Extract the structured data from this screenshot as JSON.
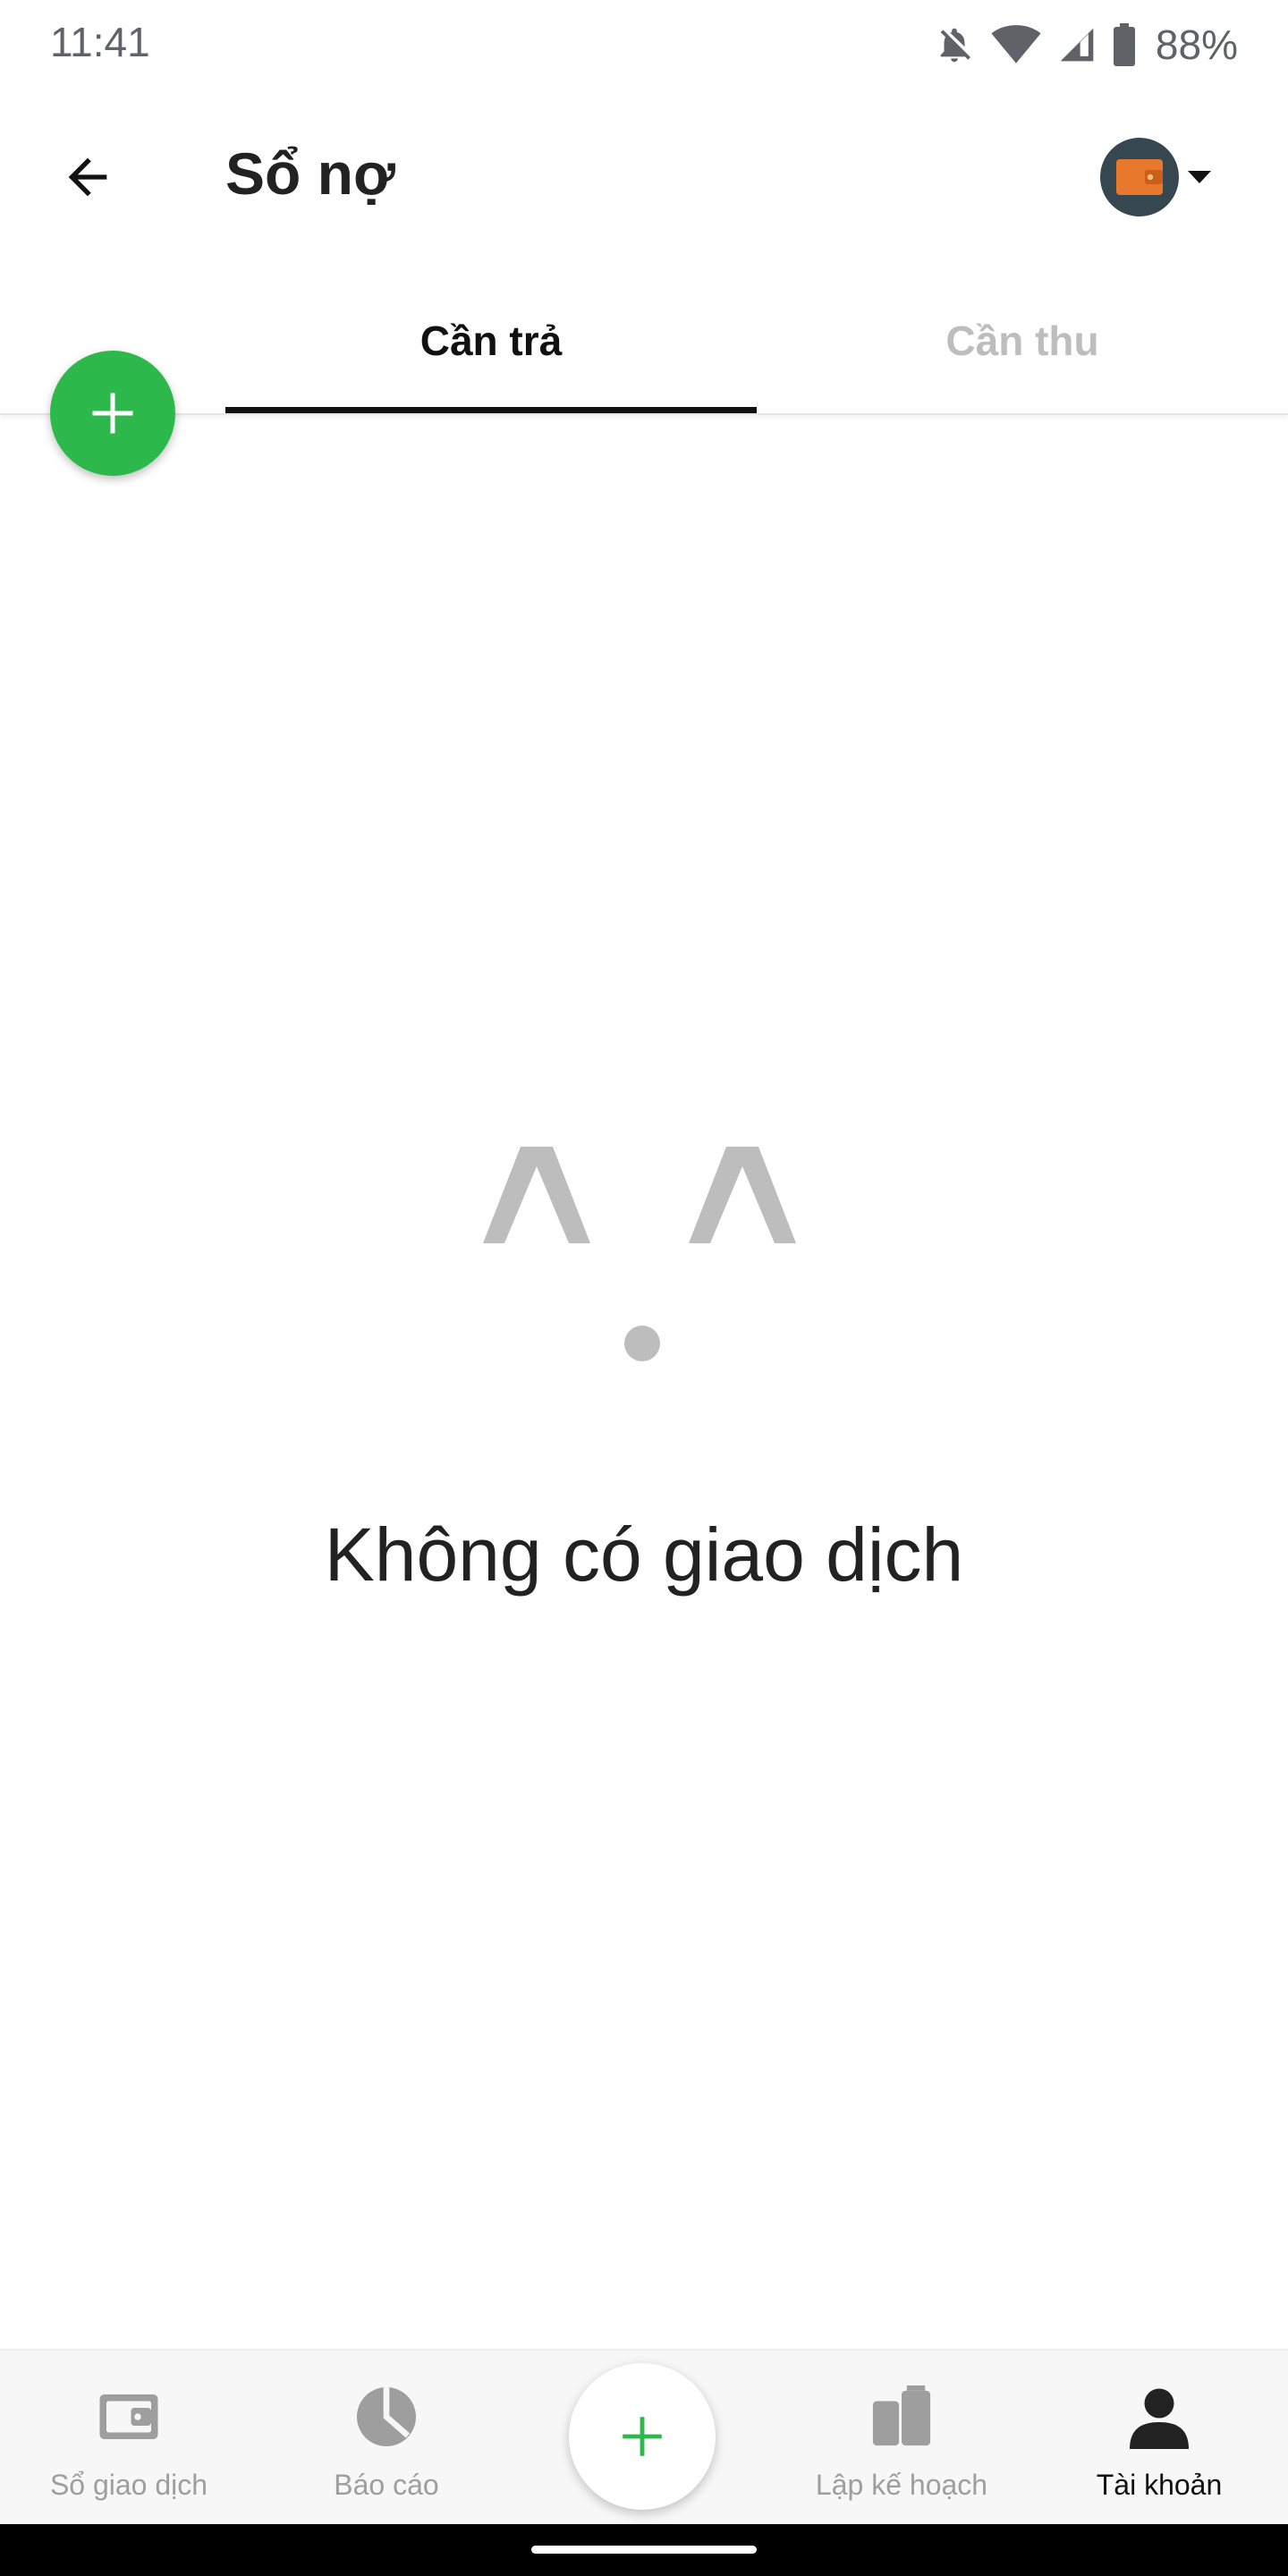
{
  "status_bar": {
    "time": "11:41",
    "battery": "88%",
    "icons": [
      "notifications-off-icon",
      "wifi-icon",
      "cellular-signal-icon",
      "battery-icon"
    ]
  },
  "app_bar": {
    "title": "Sổ nợ",
    "back_icon": "arrow-back-icon",
    "wallet_icon": "wallet-icon",
    "wallet_color": "#e8792c"
  },
  "tabs": [
    {
      "label": "Cần trả",
      "active": true
    },
    {
      "label": "Cần thu",
      "active": false
    }
  ],
  "fab": {
    "icon": "plus-icon",
    "color": "#2db84c"
  },
  "empty_state": {
    "message": "Không có giao dịch",
    "illustration": "sad-face-icon"
  },
  "bottom_nav": {
    "items": [
      {
        "label": "Sổ giao dịch",
        "icon": "wallet-icon",
        "active": false
      },
      {
        "label": "Báo cáo",
        "icon": "pie-chart-icon",
        "active": false
      },
      {
        "label": "Lập kế hoạch",
        "icon": "planning-icon",
        "active": false
      },
      {
        "label": "Tài khoản",
        "icon": "account-icon",
        "active": true
      }
    ],
    "center_icon": "plus-icon"
  },
  "colors": {
    "accent": "#2db84c",
    "inactive": "#9e9e9e",
    "text": "#222222"
  }
}
